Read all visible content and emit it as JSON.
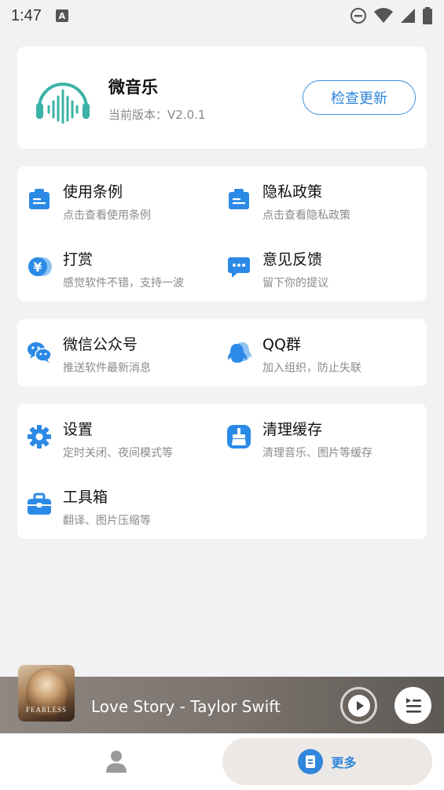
{
  "status": {
    "time": "1:47",
    "indicator": "A"
  },
  "app": {
    "name": "微音乐",
    "version": "当前版本：V2.0.1",
    "update_label": "检查更新"
  },
  "groups": [
    {
      "items": [
        {
          "title": "使用条例",
          "subtitle": "点击查看使用条例",
          "icon": "clipboard-icon"
        },
        {
          "title": "隐私政策",
          "subtitle": "点击查看隐私政策",
          "icon": "clipboard-icon"
        },
        {
          "title": "打赏",
          "subtitle": "感觉软件不错，支持一波",
          "icon": "yen-coin-icon"
        },
        {
          "title": "意见反馈",
          "subtitle": "留下你的提议",
          "icon": "chat-bubble-icon"
        }
      ]
    },
    {
      "items": [
        {
          "title": "微信公众号",
          "subtitle": "推送软件最新消息",
          "icon": "wechat-icon"
        },
        {
          "title": "QQ群",
          "subtitle": "加入组织，防止失联",
          "icon": "qq-group-icon"
        }
      ]
    },
    {
      "items": [
        {
          "title": "设置",
          "subtitle": "定时关闭、夜间模式等",
          "icon": "gear-icon"
        },
        {
          "title": "清理缓存",
          "subtitle": "清理音乐、图片等缓存",
          "icon": "broom-icon"
        },
        {
          "title": "工具箱",
          "subtitle": "翻译、图片压缩等",
          "icon": "toolbox-icon"
        }
      ]
    }
  ],
  "player": {
    "song": "Love Story  -  Taylor Swift",
    "cover_text": "FEARLESS"
  },
  "nav": {
    "more_label": "更多"
  },
  "colors": {
    "accent": "#2f86dc",
    "icon_blue": "#2b8ae6",
    "logo_teal": "#3bb3a7"
  }
}
